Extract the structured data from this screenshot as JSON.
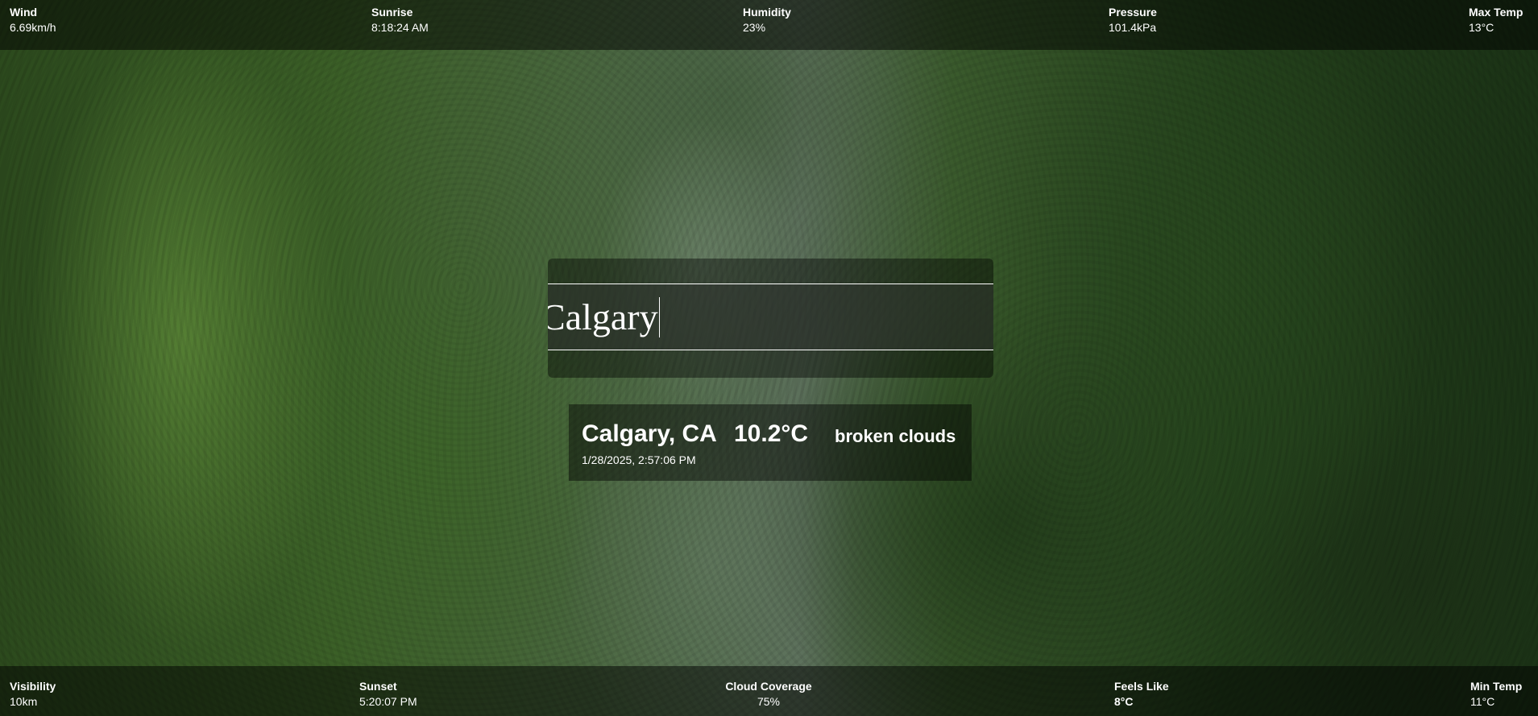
{
  "top_stats": {
    "wind": {
      "label": "Wind",
      "value": "6.69km/h"
    },
    "sunrise": {
      "label": "Sunrise",
      "value": "8:18:24 AM"
    },
    "humidity": {
      "label": "Humidity",
      "value": "23%"
    },
    "pressure": {
      "label": "Pressure",
      "value": "101.4kPa"
    },
    "max_temp": {
      "label": "Max Temp",
      "value": "13°C"
    }
  },
  "search": {
    "value": "Calgary"
  },
  "result": {
    "city": "Calgary, CA",
    "temperature": "10.2°C",
    "description": "broken clouds",
    "datetime": "1/28/2025, 2:57:06 PM"
  },
  "bottom_stats": {
    "visibility": {
      "label": "Visibility",
      "value": "10km"
    },
    "sunset": {
      "label": "Sunset",
      "value": "5:20:07 PM"
    },
    "cloud_coverage": {
      "label": "Cloud Coverage",
      "value": "75%"
    },
    "feels_like": {
      "label": "Feels Like",
      "value": "8°C"
    },
    "min_temp": {
      "label": "Min Temp",
      "value": "11°C"
    }
  }
}
